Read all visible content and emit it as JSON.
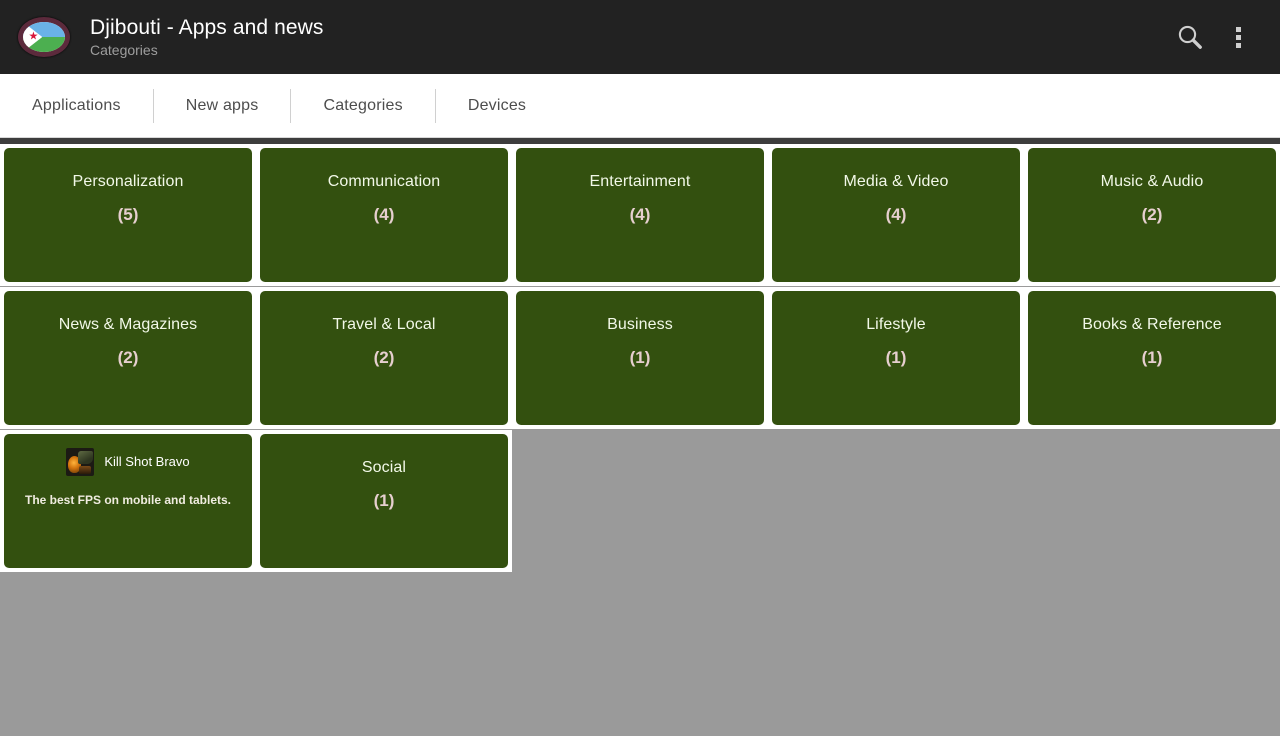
{
  "header": {
    "title": "Djibouti - Apps and news",
    "subtitle": "Categories",
    "app_icon_name": "djibouti-flag-icon",
    "search_icon": "search-icon",
    "overflow_icon": "overflow-menu-icon",
    "background_color": "#222222",
    "title_color": "#ffffff",
    "subtitle_color": "#9e9e9e"
  },
  "tabs": [
    {
      "label": "Applications",
      "selected": false
    },
    {
      "label": "New apps",
      "selected": false
    },
    {
      "label": "Categories",
      "selected": true
    },
    {
      "label": "Devices",
      "selected": false
    }
  ],
  "theme": {
    "tile_color": "#33500f",
    "tile_label_color": "#f2f8e8",
    "tile_count_color": "#e6cfcf",
    "page_background": "#9a9a9a",
    "tab_bar_background": "#ffffff",
    "divider_strip": "#3d3d3d"
  },
  "categories": [
    {
      "name": "Personalization",
      "count": "(5)"
    },
    {
      "name": "Communication",
      "count": "(4)"
    },
    {
      "name": "Entertainment",
      "count": "(4)"
    },
    {
      "name": "Media & Video",
      "count": "(4)"
    },
    {
      "name": "Music & Audio",
      "count": "(2)"
    },
    {
      "name": "News & Magazines",
      "count": "(2)"
    },
    {
      "name": "Travel & Local",
      "count": "(2)"
    },
    {
      "name": "Business",
      "count": "(1)"
    },
    {
      "name": "Lifestyle",
      "count": "(1)"
    },
    {
      "name": "Books & Reference",
      "count": "(1)"
    },
    {
      "name": "Social",
      "count": "(1)"
    }
  ],
  "ad": {
    "app_name": "Kill Shot Bravo",
    "tagline": "The best FPS on mobile and tablets.",
    "icon_name": "kill-shot-bravo-app-icon"
  }
}
